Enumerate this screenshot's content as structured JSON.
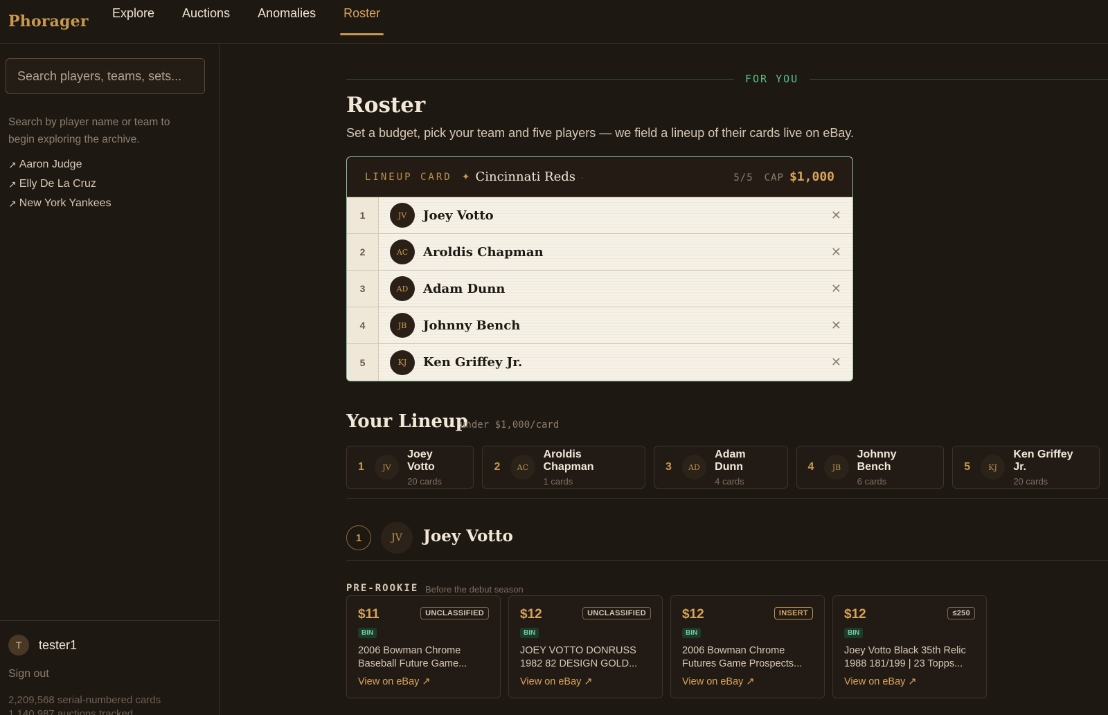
{
  "app": {
    "logo": "Phorager"
  },
  "nav": {
    "items": [
      {
        "label": "Explore"
      },
      {
        "label": "Auctions"
      },
      {
        "label": "Anomalies"
      },
      {
        "label": "Roster"
      }
    ],
    "active": "Roster"
  },
  "sidebar": {
    "search_placeholder": "Search players, teams, sets...",
    "hint": "Search by player name or team to begin exploring the archive.",
    "links": [
      {
        "label": "Aaron Judge"
      },
      {
        "label": "Elly De La Cruz"
      },
      {
        "label": "New York Yankees"
      }
    ],
    "link_icon": "↗",
    "user": {
      "initial": "T",
      "name": "tester1"
    },
    "signout": "Sign out",
    "stats": [
      "2,209,568 serial-numbered cards",
      "1,140,987 auctions tracked"
    ]
  },
  "main": {
    "section_label": "FOR YOU",
    "title": "Roster",
    "subtitle": "Set a budget, pick your team and five players — we field a lineup of their cards live on eBay.",
    "lineup_card": {
      "label": "LINEUP CARD",
      "diamond": "✦",
      "team": "Cincinnati Reds",
      "dot": "·",
      "count": "5/5",
      "cap_label": "CAP",
      "cap_value": "$1,000",
      "remove_icon": "✕",
      "rows": [
        {
          "num": "1",
          "initials": "JV",
          "name": "Joey Votto"
        },
        {
          "num": "2",
          "initials": "AC",
          "name": "Aroldis Chapman"
        },
        {
          "num": "3",
          "initials": "AD",
          "name": "Adam Dunn"
        },
        {
          "num": "4",
          "initials": "JB",
          "name": "Johnny Bench"
        },
        {
          "num": "5",
          "initials": "KJ",
          "name": "Ken Griffey Jr."
        }
      ]
    },
    "your_lineup": {
      "title": "Your Lineup",
      "subtitle": "under $1,000/card",
      "chips": [
        {
          "num": "1",
          "initials": "JV",
          "name": "Joey Votto",
          "cards": "20 cards"
        },
        {
          "num": "2",
          "initials": "AC",
          "name": "Aroldis Chapman",
          "cards": "1 cards"
        },
        {
          "num": "3",
          "initials": "AD",
          "name": "Adam Dunn",
          "cards": "4 cards"
        },
        {
          "num": "4",
          "initials": "JB",
          "name": "Johnny Bench",
          "cards": "6 cards"
        },
        {
          "num": "5",
          "initials": "KJ",
          "name": "Ken Griffey Jr.",
          "cards": "20 cards"
        }
      ]
    },
    "player_section": {
      "num": "1",
      "initials": "JV",
      "name": "Joey Votto",
      "group_label": "PRE-ROOKIE",
      "group_sub": "Before the debut season",
      "cards": [
        {
          "price": "$11",
          "tag": "UNCLASSIFIED",
          "bin": "BIN",
          "title": "2006 Bowman Chrome Baseball Future Game...",
          "link": "View on eBay ↗"
        },
        {
          "price": "$12",
          "tag": "UNCLASSIFIED",
          "bin": "BIN",
          "title": "JOEY VOTTO DONRUSS 1982 82 DESIGN GOLD...",
          "link": "View on eBay ↗"
        },
        {
          "price": "$12",
          "tag": "INSERT",
          "bin": "BIN",
          "title": "2006 Bowman Chrome Futures Game Prospects...",
          "link": "View on eBay ↗"
        },
        {
          "price": "$12",
          "tag": "≤250",
          "bin": "BIN",
          "title": "Joey Votto Black 35th Relic 1988 181/199 | 23 Topps...",
          "link": "View on eBay ↗"
        }
      ]
    }
  }
}
